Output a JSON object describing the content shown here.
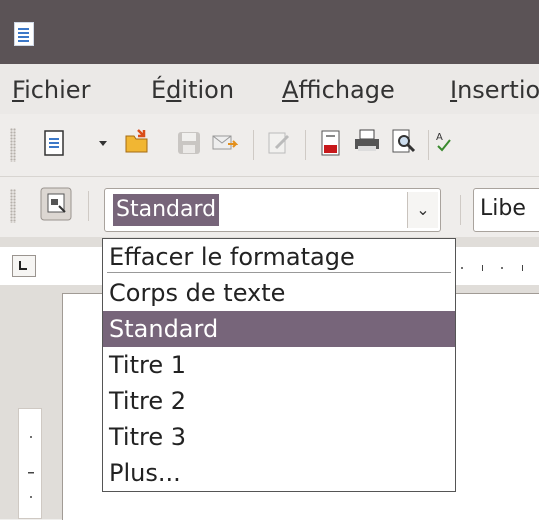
{
  "menubar": {
    "items": [
      {
        "pre": "",
        "u": "F",
        "post": "ichier"
      },
      {
        "pre": "É",
        "u": "d",
        "post": "ition"
      },
      {
        "pre": "",
        "u": "A",
        "post": "ffichage"
      },
      {
        "pre": "",
        "u": "I",
        "post": "nsertio"
      }
    ]
  },
  "style_box": {
    "value": "Standard"
  },
  "font_box": {
    "value": "Libe"
  },
  "dropdown": {
    "items": [
      "Effacer le formatage",
      "Corps de texte",
      "Standard",
      "Titre 1",
      "Titre 2",
      "Titre 3",
      "Plus..."
    ],
    "selected": "Standard"
  },
  "colors": {
    "titlebar": "#5b5356",
    "selection": "#77657a"
  }
}
